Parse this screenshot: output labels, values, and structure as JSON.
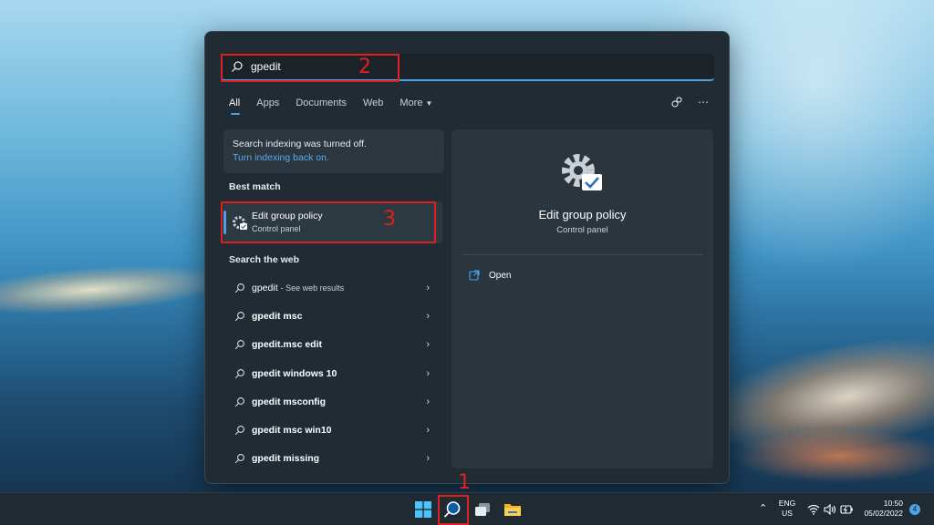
{
  "search": {
    "query": "gpedit"
  },
  "tabs": [
    {
      "label": "All",
      "active": true
    },
    {
      "label": "Apps",
      "active": false
    },
    {
      "label": "Documents",
      "active": false
    },
    {
      "label": "Web",
      "active": false
    },
    {
      "label": "More",
      "active": false,
      "icon": "chevron-down-icon"
    }
  ],
  "toolbar_icons": [
    "share-icon",
    "more-icon"
  ],
  "notice": {
    "text": "Search indexing was turned off.",
    "link": "Turn indexing back on."
  },
  "best_match": {
    "section_title": "Best match",
    "title": "Edit group policy",
    "subtitle": "Control panel",
    "icon": "gear-check-icon"
  },
  "web": {
    "section_title": "Search the web",
    "items": [
      {
        "query": "gpedit",
        "suffix": "- See web results"
      },
      {
        "query": "gpedit msc",
        "suffix": ""
      },
      {
        "query": "gpedit.msc edit",
        "suffix": ""
      },
      {
        "query": "gpedit windows 10",
        "suffix": ""
      },
      {
        "query": "gpedit msconfig",
        "suffix": ""
      },
      {
        "query": "gpedit msc win10",
        "suffix": ""
      },
      {
        "query": "gpedit missing",
        "suffix": ""
      }
    ]
  },
  "detail": {
    "title": "Edit group policy",
    "subtitle": "Control panel",
    "open_label": "Open"
  },
  "annotations": {
    "one": "1",
    "two": "2",
    "three": "3",
    "color": "#e02020"
  },
  "taskbar": {
    "apps": [
      "windows-start-icon",
      "search-icon",
      "task-view-icon",
      "file-explorer-icon"
    ],
    "tray_icons": [
      "chevron-up-icon",
      "wifi-icon",
      "volume-icon",
      "battery-icon"
    ],
    "lang_line1": "ENG",
    "lang_line2": "US",
    "time": "10:50",
    "date": "05/02/2022",
    "notification_count": "4"
  },
  "colors": {
    "accent": "#4aa3e8",
    "panel_bg": "#202b33"
  }
}
